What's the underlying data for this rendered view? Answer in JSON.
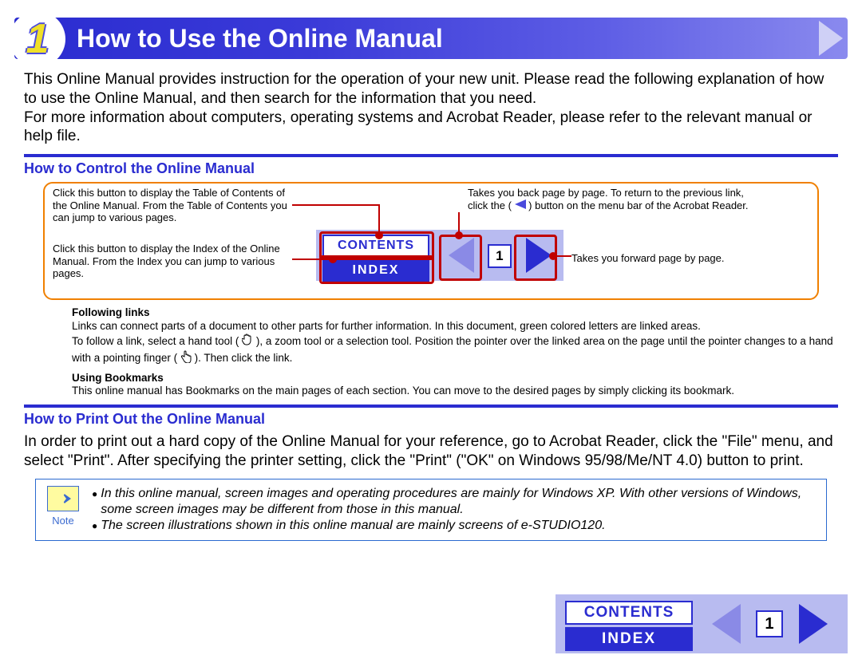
{
  "header": {
    "chapter_number": "1",
    "title": "How to Use the Online Manual"
  },
  "intro": {
    "para": "This Online Manual provides instruction for the operation of your new unit. Please read the following explanation of how to use the Online Manual, and then search for the information that you need.\nFor more information about computers, operating systems and Acrobat Reader, please refer to the relevant manual or help file."
  },
  "section1": {
    "heading": "How to Control the Online Manual",
    "callouts": {
      "contents": "Click this button to display the Table of Contents of the Online Manual. From the Table of Contents you can jump to various pages.",
      "index": "Click this button to display the Index of the Online Manual. From the Index you can jump to various pages.",
      "back_line1": "Takes you back page by page. To return to the previous link,",
      "back_line2a": "click the (",
      "back_line2b": ") button on the menu bar of the Acrobat Reader.",
      "forward": "Takes you forward page by page."
    },
    "nav": {
      "contents_label": "CONTENTS",
      "index_label": "INDEX",
      "page": "1"
    },
    "following": {
      "links_heading": "Following links",
      "links_body_a": "Links can connect parts of a document to other parts for further information. In this document, green colored letters are linked areas.\nTo follow a link, select a hand tool (",
      "links_body_b": "), a zoom tool or a selection tool. Position the pointer over the linked area on the page until the pointer changes to a hand with a pointing finger (",
      "links_body_c": "). Then click the link.",
      "bookmarks_heading": "Using Bookmarks",
      "bookmarks_body": "This online manual has Bookmarks on the main pages of each section. You can move to the desired pages by simply clicking its bookmark."
    }
  },
  "section2": {
    "heading": "How to Print Out the Online Manual",
    "body": "In order to print out a hard copy of the Online Manual for your reference, go to Acrobat Reader, click the \"File\" menu, and select \"Print\". After specifying the printer setting, click the \"Print\" (\"OK\" on Windows 95/98/Me/NT 4.0) button to print."
  },
  "note": {
    "label": "Note",
    "bullet1": "In this online manual, screen images and operating procedures are mainly for Windows XP. With other versions of Windows, some screen images may be different from those in this manual.",
    "bullet2": "The screen illustrations shown in this online manual are mainly screens of e-STUDIO120."
  },
  "footer": {
    "contents_label": "CONTENTS",
    "index_label": "INDEX",
    "page": "1"
  }
}
